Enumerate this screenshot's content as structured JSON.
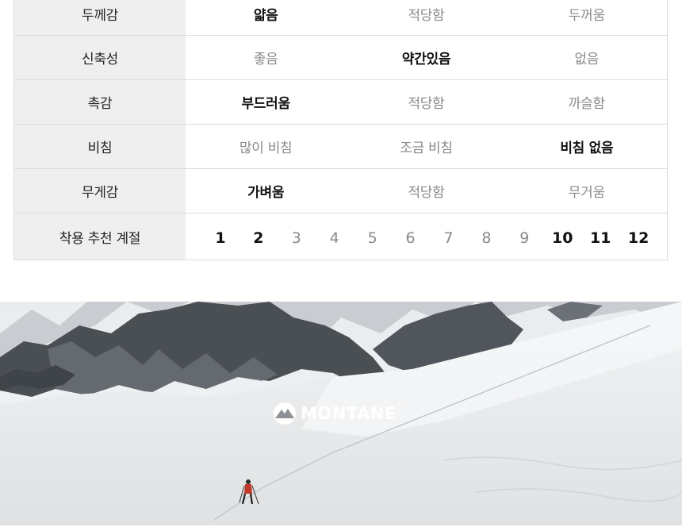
{
  "spec_table": {
    "rows": [
      {
        "label": "두께감",
        "options": [
          {
            "text": "얇음",
            "selected": true
          },
          {
            "text": "적당함",
            "selected": false
          },
          {
            "text": "두꺼움",
            "selected": false
          }
        ]
      },
      {
        "label": "신축성",
        "options": [
          {
            "text": "좋음",
            "selected": false
          },
          {
            "text": "약간있음",
            "selected": true
          },
          {
            "text": "없음",
            "selected": false
          }
        ]
      },
      {
        "label": "촉감",
        "options": [
          {
            "text": "부드러움",
            "selected": true
          },
          {
            "text": "적당함",
            "selected": false
          },
          {
            "text": "까슬함",
            "selected": false
          }
        ]
      },
      {
        "label": "비침",
        "options": [
          {
            "text": "많이 비침",
            "selected": false
          },
          {
            "text": "조금 비침",
            "selected": false
          },
          {
            "text": "비침 없음",
            "selected": true
          }
        ]
      },
      {
        "label": "무게감",
        "options": [
          {
            "text": "가벼움",
            "selected": true
          },
          {
            "text": "적당함",
            "selected": false
          },
          {
            "text": "무거움",
            "selected": false
          }
        ]
      }
    ],
    "season": {
      "label": "착용 추천 계절",
      "months": [
        {
          "text": "1",
          "selected": true
        },
        {
          "text": "2",
          "selected": true
        },
        {
          "text": "3",
          "selected": false
        },
        {
          "text": "4",
          "selected": false
        },
        {
          "text": "5",
          "selected": false
        },
        {
          "text": "6",
          "selected": false
        },
        {
          "text": "7",
          "selected": false
        },
        {
          "text": "8",
          "selected": false
        },
        {
          "text": "9",
          "selected": false
        },
        {
          "text": "10",
          "selected": true
        },
        {
          "text": "11",
          "selected": true
        },
        {
          "text": "12",
          "selected": true
        }
      ]
    }
  },
  "banner": {
    "logo_text": "MONTANE",
    "logo_mark": "®",
    "logo_icon": "mountain-circle-icon"
  },
  "colors": {
    "selected_text": "#111111",
    "unselected_text": "#8a8a8a",
    "label_bg": "#efefef",
    "border": "#dcdcdc"
  }
}
